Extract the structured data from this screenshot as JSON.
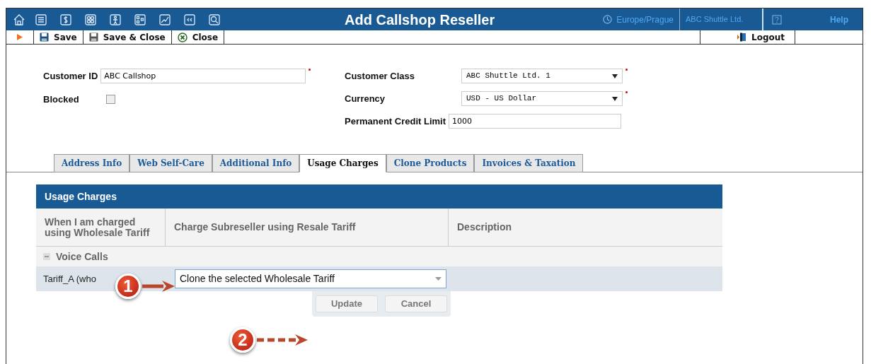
{
  "header": {
    "title": "Add Callshop Reseller",
    "timezone": "Europe/Prague",
    "company": "ABC Shuttle Ltd.",
    "help": "Help"
  },
  "toolbar": {
    "buttons": [
      {
        "label": "Save",
        "kind": "save"
      },
      {
        "label": "Save & Close",
        "kind": "save-close"
      },
      {
        "label": "Close",
        "kind": "close"
      }
    ],
    "logout": "Logout"
  },
  "form": {
    "left": [
      {
        "label": "Customer ID",
        "kind": "text",
        "value": "ABC Callshop",
        "required": true
      },
      {
        "label": "Blocked",
        "kind": "checkbox",
        "checked": false
      }
    ],
    "right": [
      {
        "label": "Customer Class",
        "kind": "select",
        "value": "ABC Shuttle Ltd. 1",
        "required": true
      },
      {
        "label": "Currency",
        "kind": "select",
        "value": "USD - US Dollar",
        "required": true
      },
      {
        "label": "Permanent Credit Limit",
        "kind": "text",
        "value": "1000",
        "required": false
      }
    ]
  },
  "tabs": [
    {
      "label": "Address Info",
      "selected": false
    },
    {
      "label": "Web Self-Care",
      "selected": false
    },
    {
      "label": "Additional Info",
      "selected": false
    },
    {
      "label": "Usage Charges",
      "selected": true
    },
    {
      "label": "Clone Products",
      "selected": false
    },
    {
      "label": "Invoices & Taxation",
      "selected": false
    }
  ],
  "panel": {
    "title": "Usage Charges",
    "columns": [
      "When I am charged using Wholesale Tariff",
      "Charge Subreseller using Resale Tariff",
      "Description"
    ],
    "group": {
      "label": "Voice Calls",
      "expanded": true
    },
    "row": {
      "tariff": "Tariff_A (who",
      "value": "Clone the selected Wholesale Tariff"
    },
    "buttons": [
      "Update",
      "Cancel"
    ]
  },
  "callouts": [
    "1",
    "2"
  ]
}
